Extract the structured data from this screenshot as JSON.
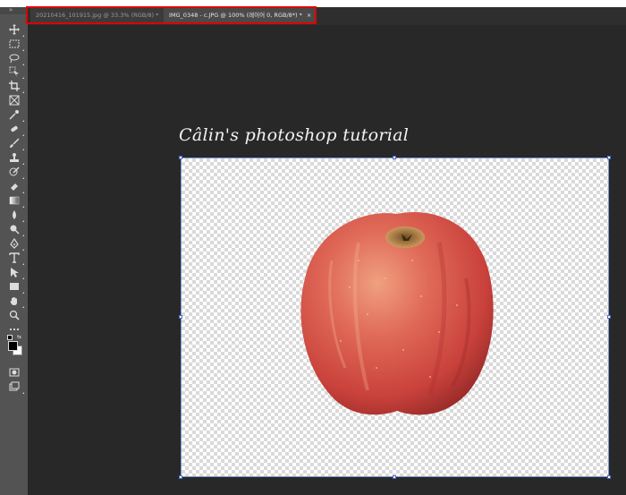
{
  "window": {
    "tabs": [
      {
        "label": "20210416_101915.jpg @ 33.3% (RGB/8) *",
        "close": "×",
        "active": false
      },
      {
        "label": "IMG_0348 - c.JPG @ 100% (레이어 0, RGB/8*) *",
        "close": "×",
        "active": true
      }
    ]
  },
  "toolbar": {
    "collapse_glyph": "»",
    "tools": [
      "move-icon",
      "marquee-icon",
      "lasso-icon",
      "object-select-icon",
      "crop-icon",
      "frame-icon",
      "eyedropper-icon",
      "healing-brush-icon",
      "brush-icon",
      "clone-stamp-icon",
      "history-brush-icon",
      "eraser-icon",
      "gradient-icon",
      "blur-icon",
      "dodge-icon",
      "pen-icon",
      "type-icon",
      "path-select-icon",
      "rectangle-icon",
      "hand-icon",
      "zoom-icon",
      "more-tools-icon"
    ],
    "foreground_color": "#000000",
    "background_color": "#ffffff"
  },
  "canvas": {
    "watermark": "Câlin's photoshop tutorial",
    "subject": "apple-image",
    "colors": {
      "apple_main": "#d9504a",
      "apple_light": "#ec8f74",
      "apple_dark": "#a92e2a",
      "selection": "#4a6fc4"
    }
  }
}
